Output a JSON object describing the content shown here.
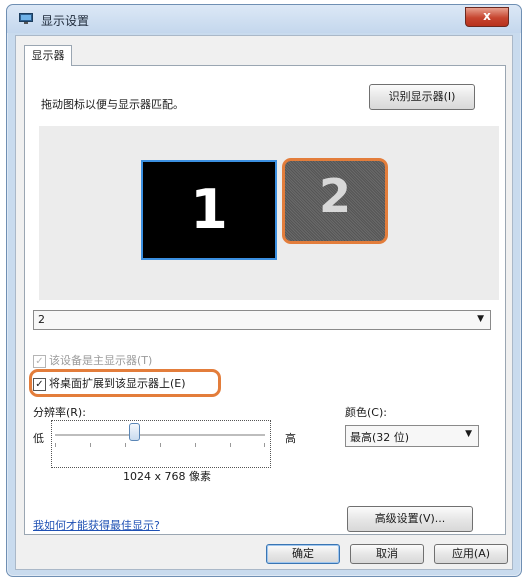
{
  "window": {
    "title": "显示设置",
    "close_label": "x"
  },
  "tabs": [
    {
      "label": "显示器"
    }
  ],
  "monitor": {
    "instruction": "拖动图标以便与显示器匹配。",
    "identify_button": "识别显示器(I)",
    "monitors": [
      {
        "number": "1"
      },
      {
        "number": "2"
      }
    ],
    "selected_display": "2"
  },
  "options": {
    "primary_checkbox": {
      "label": "该设备是主显示器(T)",
      "checked": true,
      "disabled": true
    },
    "extend_checkbox": {
      "label": "将桌面扩展到该显示器上(E)",
      "checked": true
    }
  },
  "resolution": {
    "label": "分辨率(R):",
    "low": "低",
    "high": "高",
    "value": "1024 x 768 像素"
  },
  "color": {
    "label": "颜色(C):",
    "selected": "最高(32 位)"
  },
  "footer": {
    "help_link": "我如何才能获得最佳显示?",
    "advanced_button": "高级设置(V)...",
    "ok_button": "确定",
    "cancel_button": "取消",
    "apply_button": "应用(A)"
  },
  "colors": {
    "highlight": "#e37d3b",
    "monitor1_border": "#3b8fe0"
  }
}
